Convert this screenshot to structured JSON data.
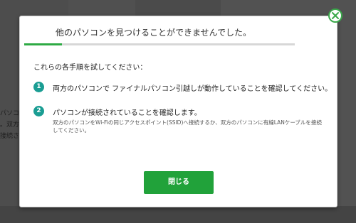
{
  "background": {
    "partial_text_lines": [
      "パソコン",
      "。双方",
      "接続され"
    ]
  },
  "dialog": {
    "title": "他のパソコンを見つけることができませんでした。",
    "progress_fraction": 0.14,
    "instructions_heading": "これらの各手順を試してください：",
    "steps": [
      {
        "number": "1",
        "text": "両方のパソコンで ファイナルパソコン引越しが動作していることを確認してください。",
        "subtext": ""
      },
      {
        "number": "2",
        "text": "パソコンが接続されていることを確認します。",
        "subtext": "双方のパソコンをWi-Fiの同じアクセスポイント(SSID)へ接続するか、双方のパソコンに有線LANケーブルを接続してください。"
      }
    ],
    "close_button_label": "閉じる",
    "close_icon": "close-circle-icon",
    "colors": {
      "accent": "#21a23a",
      "step_badge": "#1a9d93",
      "progress": "#2eaa44"
    }
  }
}
